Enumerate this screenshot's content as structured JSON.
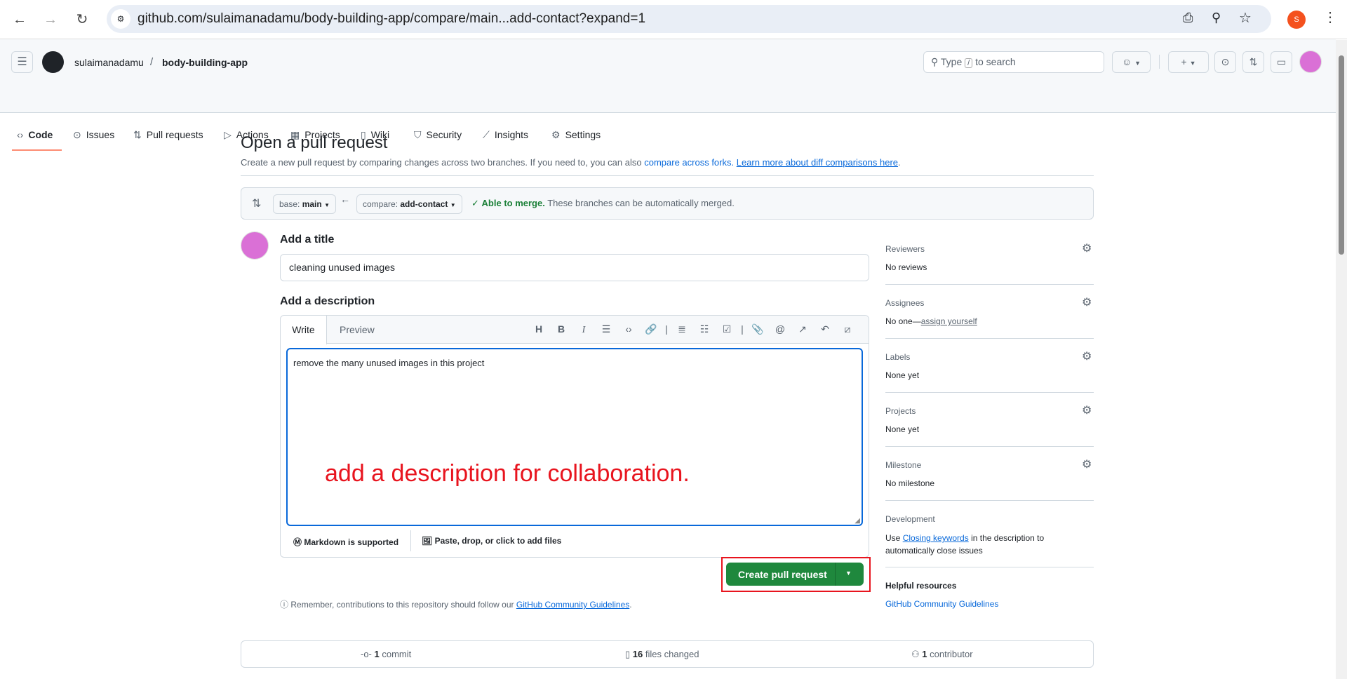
{
  "browser": {
    "url": "github.com/sulaimanadamu/body-building-app/compare/main...add-contact?expand=1",
    "profile_initial": "S"
  },
  "header": {
    "owner": "sulaimanadamu",
    "separator": "/",
    "repo": "body-building-app",
    "search_prefix": "Type",
    "search_key": "/",
    "search_suffix": "to search"
  },
  "tabs": [
    {
      "label": "Code",
      "icon": "code-icon"
    },
    {
      "label": "Issues",
      "icon": "issue-icon"
    },
    {
      "label": "Pull requests",
      "icon": "pull-request-icon"
    },
    {
      "label": "Actions",
      "icon": "play-icon"
    },
    {
      "label": "Projects",
      "icon": "table-icon"
    },
    {
      "label": "Wiki",
      "icon": "book-icon"
    },
    {
      "label": "Security",
      "icon": "shield-icon"
    },
    {
      "label": "Insights",
      "icon": "graph-icon"
    },
    {
      "label": "Settings",
      "icon": "gear-icon"
    }
  ],
  "page": {
    "title": "Open a pull request",
    "subtitle": "Create a new pull request by comparing changes across two branches. If you need to, you can also",
    "link1": "compare across forks.",
    "link2": "Learn more about diff comparisons here",
    "period": "."
  },
  "compare": {
    "base_label": "base:",
    "base": "main",
    "compare_label": "compare:",
    "compare": "add-contact",
    "merge_status": "Able to merge.",
    "merge_note": "These branches can be automatically merged."
  },
  "form": {
    "title_label": "Add a title",
    "title_value": "cleaning unused images",
    "desc_label": "Add a description",
    "tab_write": "Write",
    "tab_preview": "Preview",
    "desc_value": "remove the many unused images in this project",
    "markdown_note": "Markdown is supported",
    "attach_note": "Paste, drop, or click to add files",
    "submit": "Create pull request",
    "remember": "Remember, contributions to this repository should follow our",
    "guidelines": "GitHub Community Guidelines"
  },
  "annotation": {
    "text": "add a description for collaboration.",
    "color": "#e8141e"
  },
  "sidebar": {
    "reviewers": {
      "label": "Reviewers",
      "value": "No reviews"
    },
    "assignees": {
      "label": "Assignees",
      "value": "No one—",
      "link": "assign yourself"
    },
    "labels": {
      "label": "Labels",
      "value": "None yet"
    },
    "projects": {
      "label": "Projects",
      "value": "None yet"
    },
    "milestone": {
      "label": "Milestone",
      "value": "No milestone"
    },
    "development": {
      "label": "Development",
      "pre": "Use",
      "link": "Closing keywords",
      "post": "in the description to automatically close issues"
    },
    "resources": {
      "label": "Helpful resources",
      "link": "GitHub Community Guidelines"
    }
  },
  "summary": {
    "commits_n": "1",
    "commits": "commit",
    "files_n": "16",
    "files": "files changed",
    "contrib_n": "1",
    "contrib": "contributor"
  }
}
